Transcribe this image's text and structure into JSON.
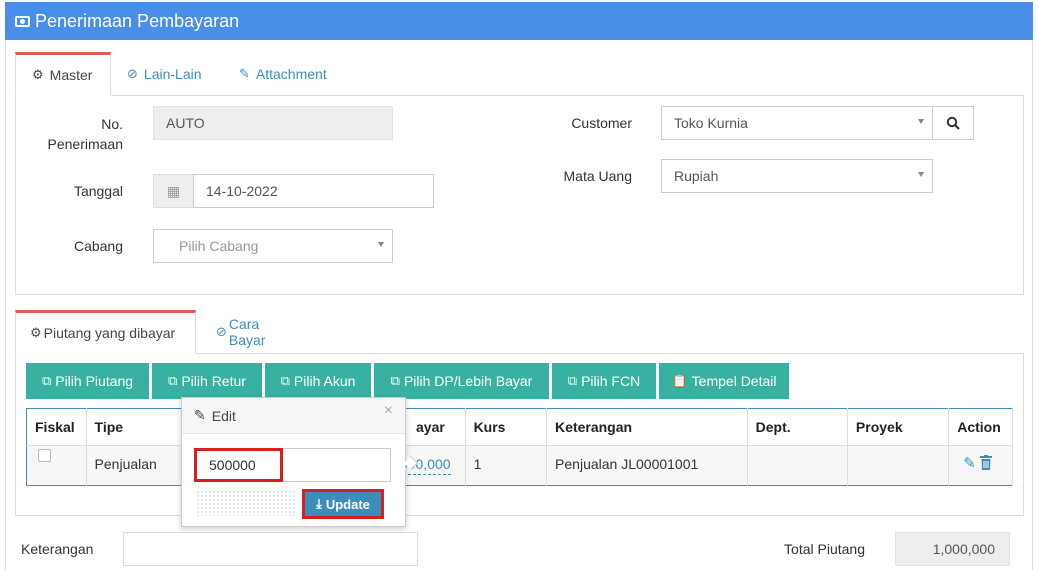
{
  "header": {
    "title": "Penerimaan Pembayaran",
    "icon": "money-icon"
  },
  "top_tabs": [
    {
      "label": "Master",
      "icon": "cogs-icon",
      "active": true
    },
    {
      "label": "Lain-Lain",
      "icon": "check-circle-icon",
      "active": false
    },
    {
      "label": "Attachment",
      "icon": "paperclip-icon",
      "active": false
    }
  ],
  "master": {
    "no_penerimaan_label_1": "No.",
    "no_penerimaan_label_2": "Penerimaan",
    "no_penerimaan_value": "AUTO",
    "tanggal_label": "Tanggal",
    "tanggal_value": "14-10-2022",
    "cabang_label": "Cabang",
    "cabang_placeholder": "Pilih Cabang",
    "customer_label": "Customer",
    "customer_value": "Toko Kurnia",
    "mata_uang_label": "Mata Uang",
    "mata_uang_value": "Rupiah"
  },
  "detail_tabs": [
    {
      "label": "Piutang yang dibayar",
      "icon": "cogs-icon",
      "active": true
    },
    {
      "label": "Cara Bayar",
      "icon": "check-circle-icon",
      "active": false
    }
  ],
  "toolbar": [
    {
      "label": "Pilih Piutang",
      "icon": "copy-icon"
    },
    {
      "label": "Pilih Retur",
      "icon": "copy-icon"
    },
    {
      "label": "Pilih Akun",
      "icon": "copy-icon"
    },
    {
      "label": "Pilih DP/Lebih Bayar",
      "icon": "copy-icon"
    },
    {
      "label": "Pilih FCN",
      "icon": "copy-icon"
    },
    {
      "label": "Tempel Detail",
      "icon": "paste-icon"
    }
  ],
  "table": {
    "headers": [
      "Fiskal",
      "Tipe",
      "ayar",
      "Kurs",
      "Keterangan",
      "Dept.",
      "Proyek",
      "Action"
    ],
    "rows": [
      {
        "tipe": "Penjualan",
        "bayar": "1,000,000",
        "kurs": "1",
        "keterangan": "Penjualan JL00001001",
        "dept": "",
        "proyek": ""
      }
    ]
  },
  "popover": {
    "title": "Edit",
    "input_value": "500000",
    "update_label": "Update"
  },
  "footer": {
    "keterangan_label": "Keterangan",
    "total_label": "Total Piutang",
    "total_value": "1,000,000"
  },
  "colors": {
    "header": "#4a8fe7",
    "toolbar": "#39b1a2",
    "link": "#3c8dbc",
    "highlight": "#d62020"
  }
}
